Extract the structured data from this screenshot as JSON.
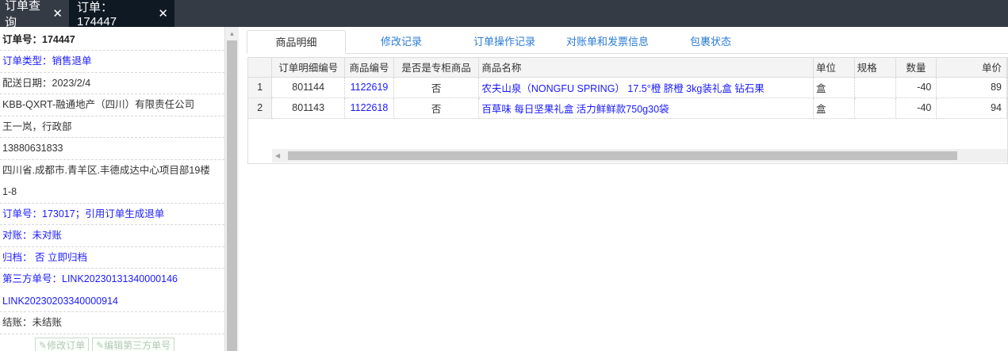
{
  "tabs": [
    {
      "label": "订单查询",
      "close": "✕"
    },
    {
      "label": "订单：174447",
      "close": "✕"
    }
  ],
  "left_panel": {
    "order_no": "订单号：174447",
    "order_type": "订单类型：销售退单",
    "delivery_date": "配送日期：2023/2/4",
    "company": "KBB-QXRT-融通地产（四川）有限责任公司",
    "contact": "王一岚，行政部",
    "phone": "13880631833",
    "address_line1": "四川省.成都市.青羊区.丰德成达中心项目部19楼",
    "address_line2": "1-8",
    "ref_order": "订单号：173017；引用订单生成退单",
    "reconcile": "对账：未对账",
    "archive": "归档： 否 立即归档",
    "third_party_1": "第三方单号：LINK20230131340000146",
    "third_party_2": "LINK20230203340000914",
    "settlement": "结账：未结账",
    "edit_order_btn": "修改订单",
    "edit_third_btn": "编辑第三方单号"
  },
  "detail_tabs": [
    "商品明细",
    "修改记录",
    "订单操作记录",
    "对账单和发票信息",
    "包裹状态"
  ],
  "table": {
    "headers": [
      "订单明细编号",
      "商品编号",
      "是否是专柜商品",
      "商品名称",
      "单位",
      "规格",
      "数量",
      "单价"
    ],
    "rows": [
      {
        "rownum": "1",
        "detail_no": "801144",
        "item_no": "1122619",
        "counter": "否",
        "name": "农夫山泉（NONGFU SPRING） 17.5°橙 脐橙 3kg装礼盒 钻石果",
        "unit": "盒",
        "spec": "",
        "qty": "-40",
        "price": "89"
      },
      {
        "rownum": "2",
        "detail_no": "801143",
        "item_no": "1122618",
        "counter": "否",
        "name": "百草味 每日坚果礼盒 活力鲜鲜款750g30袋",
        "unit": "盒",
        "spec": "",
        "qty": "-40",
        "price": "94"
      }
    ]
  },
  "colors": {
    "tabbar": "#343b45",
    "active_tab": "#0f1923",
    "link": "#1a1aff",
    "tab_link": "#2a7bd6"
  },
  "icons": [
    "close-icon",
    "edit-icon",
    "scroll-up-arrow-icon",
    "scroll-left-arrow-icon"
  ]
}
